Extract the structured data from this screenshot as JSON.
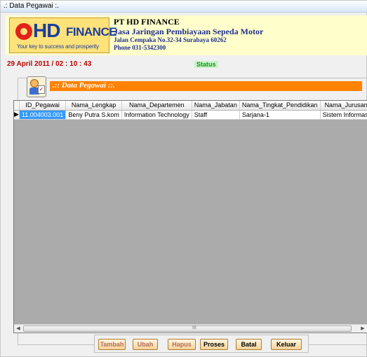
{
  "window": {
    "title": ".: Data Pegawai :."
  },
  "header": {
    "logo_hd": "HD",
    "logo_finance": "FINANCE",
    "logo_tagline": "Your key to success and prosperity",
    "company_name": "PT HD FINANCE",
    "company_desc": "Jasa Jaringan Pembiayaan Sepeda Motor",
    "company_address": "Jalan Cempaka No.32-34 Surabaya 60262",
    "company_phone": "Phone 031-5342300"
  },
  "statusbar": {
    "datetime": "29 April 2011  / 02 : 10  : 43",
    "status": "Status"
  },
  "panel": {
    "title": ".:: Data Pegawai ::."
  },
  "grid": {
    "columns": [
      "ID_Pegawai",
      "Nama_Lengkap",
      "Nama_Departemen",
      "Nama_Jabatan",
      "Nama_Tingkat_Pendidikan",
      "Nama_Jurusan"
    ],
    "rows": [
      [
        "11.004003.001",
        "Beny Putra S.kom",
        "Information Technology",
        "Staff",
        "Sarjana-1",
        "Sistem Informasi"
      ]
    ],
    "row_indicator": "▶",
    "scroll_grip": "III"
  },
  "buttons": {
    "tambah": "Tambah",
    "ubah": "Ubah",
    "hapus": "Hapus",
    "proses": "Proses",
    "batal": "Batal",
    "keluar": "Keluar"
  },
  "colors": {
    "accent": "#ff8200",
    "date": "#c00000",
    "status": "#00a000",
    "selection": "#3399ff"
  }
}
